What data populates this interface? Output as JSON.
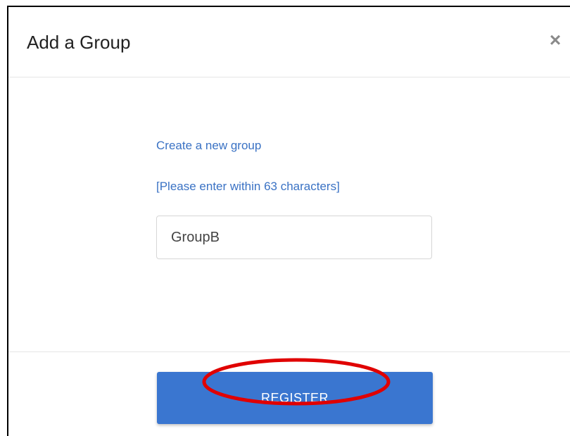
{
  "dialog": {
    "title": "Add a Group",
    "close_label": "×"
  },
  "form": {
    "heading": "Create a new group",
    "hint": "[Please enter within 63 characters]",
    "group_name_value": "GroupB"
  },
  "footer": {
    "register_label": "REGISTER"
  },
  "colors": {
    "accent_text": "#3a72c4",
    "button_bg": "#3a76d0",
    "annotation": "#e00000"
  }
}
